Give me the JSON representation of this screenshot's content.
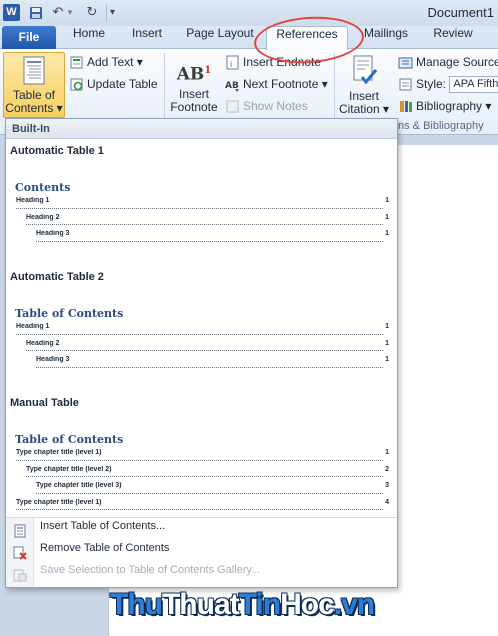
{
  "window": {
    "title": "Document1",
    "app_logo": "W"
  },
  "quick_access": {
    "undo_symbol": "↶",
    "redo_symbol": "↻",
    "customize_symbol": "▾"
  },
  "tabs": [
    "File",
    "Home",
    "Insert",
    "Page Layout",
    "References",
    "Mailings",
    "Review"
  ],
  "active_tab": "References",
  "ribbon": {
    "toc": {
      "label_line1": "Table of",
      "label_line2": "Contents ▾"
    },
    "add_text": "Add Text ▾",
    "update_table": "Update Table",
    "insert_footnote": {
      "label_line1": "Insert",
      "label_line2": "Footnote",
      "icon_text": "AB",
      "icon_sup": "1"
    },
    "insert_endnote": "Insert Endnote",
    "next_footnote": "Next Footnote ▾",
    "show_notes": "Show Notes",
    "insert_citation": {
      "label_line1": "Insert",
      "label_line2": "Citation ▾"
    },
    "manage_sources": "Manage Source",
    "style_label": "Style:",
    "style_value": "APA Fifth",
    "bibliography": "Bibliography ▾",
    "group_citations": "ns & Bibliography"
  },
  "dropdown": {
    "header": "Built-In",
    "galleries": [
      {
        "title": "Automatic Table 1",
        "heading": "Contents",
        "lines": [
          {
            "text": "Heading 1",
            "page": "1",
            "level": 1
          },
          {
            "text": "Heading 2",
            "page": "1",
            "level": 2
          },
          {
            "text": "Heading 3",
            "page": "1",
            "level": 3
          }
        ]
      },
      {
        "title": "Automatic Table 2",
        "heading": "Table of Contents",
        "lines": [
          {
            "text": "Heading 1",
            "page": "1",
            "level": 1
          },
          {
            "text": "Heading 2",
            "page": "1",
            "level": 2
          },
          {
            "text": "Heading 3",
            "page": "1",
            "level": 3
          }
        ]
      },
      {
        "title": "Manual Table",
        "heading": "Table of Contents",
        "lines": [
          {
            "text": "Type chapter title (level 1)",
            "page": "1",
            "level": 1
          },
          {
            "text": "Type chapter title (level 2)",
            "page": "2",
            "level": 2
          },
          {
            "text": "Type chapter title (level 3)",
            "page": "3",
            "level": 3
          },
          {
            "text": "Type chapter title (level 1)",
            "page": "4",
            "level": 1
          }
        ]
      }
    ],
    "menu": {
      "insert_toc": "Insert Table of Contents...",
      "remove_toc": "Remove Table of Contents",
      "save_selection": "Save Selection to Table of Contents Gallery..."
    }
  },
  "watermark": {
    "part1": "Thu",
    "part2": "Thuat",
    "part3": "Tin",
    "part4": "Hoc",
    "part5": ".vn"
  },
  "colors": {
    "accent": "#2157a8",
    "highlight": "#e0463e",
    "heading": "#2b4b80",
    "watermark_blue": "#2e7fd6",
    "watermark_dark": "#0b2d55"
  }
}
